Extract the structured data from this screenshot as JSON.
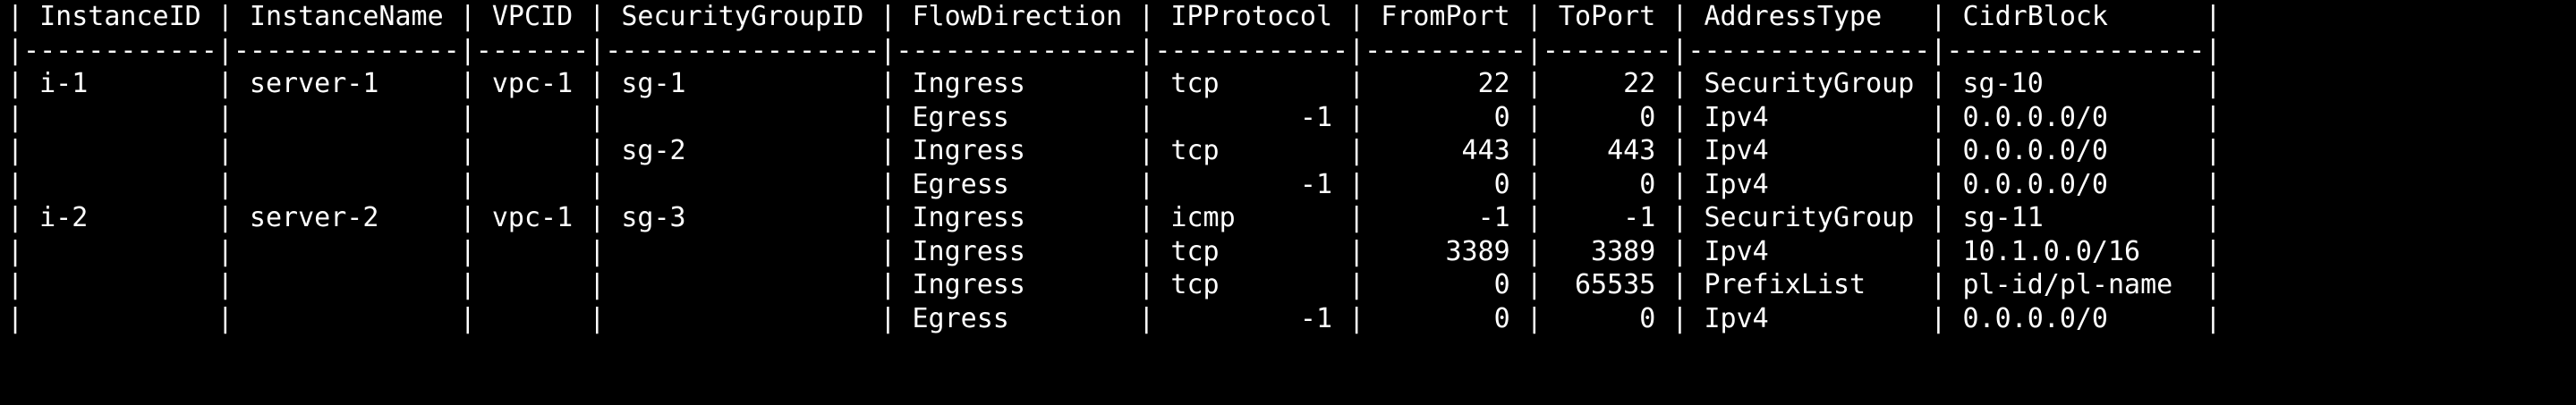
{
  "terminal": {
    "header": "| InstanceID | InstanceName | VPCID | SecurityGroupID | FlowDirection | IPProtocol | FromPort | ToPort | AddressType   | CidrBlock      |",
    "separator": "|------------|--------------|-------|-----------------|---------------|------------|----------|--------|---------------|----------------|",
    "rows": [
      "| i-1        | server-1     | vpc-1 | sg-1            | Ingress       | tcp        |       22 |     22 | SecurityGroup | sg-10          |",
      "|            |              |       |                 | Egress        |         -1 |        0 |      0 | Ipv4          | 0.0.0.0/0      |",
      "|            |              |       | sg-2            | Ingress       | tcp        |      443 |    443 | Ipv4          | 0.0.0.0/0      |",
      "|            |              |       |                 | Egress        |         -1 |        0 |      0 | Ipv4          | 0.0.0.0/0      |",
      "| i-2        | server-2     | vpc-1 | sg-3            | Ingress       | icmp       |       -1 |     -1 | SecurityGroup | sg-11          |",
      "|            |              |       |                 | Ingress       | tcp        |     3389 |   3389 | Ipv4          | 10.1.0.0/16    |",
      "|            |              |       |                 | Ingress       | tcp        |        0 |  65535 | PrefixList    | pl-id/pl-name  |",
      "|            |              |       |                 | Egress        |         -1 |        0 |      0 | Ipv4          | 0.0.0.0/0      |"
    ]
  }
}
